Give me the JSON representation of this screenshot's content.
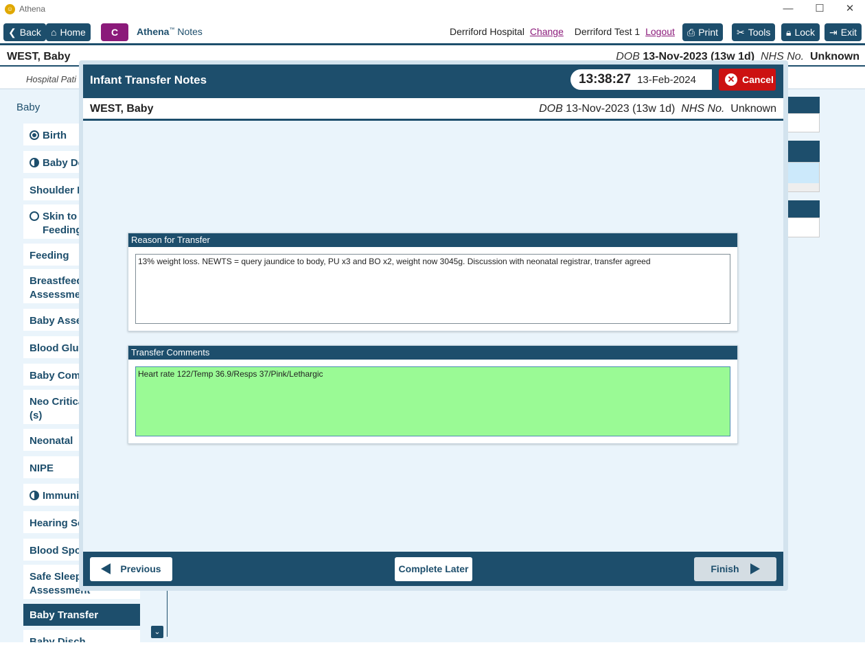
{
  "window": {
    "app_name": "Athena",
    "logo_glyph": "⌂"
  },
  "toolbar": {
    "back_label": "Back",
    "home_label": "Home",
    "c_label": "C",
    "brand": "Athena",
    "brand_tm": "™",
    "brand_suffix": "Notes",
    "hospital": "Derriford Hospital",
    "change_link": "Change",
    "user": "Derriford Test 1",
    "logout_link": "Logout",
    "print_label": "Print",
    "tools_label": "Tools",
    "lock_label": "Lock",
    "exit_label": "Exit"
  },
  "patient": {
    "name": "WEST, Baby",
    "dob_label": "DOB",
    "dob": "13-Nov-2023 (13w 1d)",
    "nhs_label": "NHS No.",
    "nhs": "Unknown"
  },
  "subbar_text": "Hospital Pati",
  "sidebar": {
    "header": "Baby",
    "items": [
      {
        "label": "Birth",
        "state": "complete"
      },
      {
        "label": "Baby De",
        "state": "partial"
      },
      {
        "label": "Shoulder D",
        "state": "none"
      },
      {
        "label": "Skin to S\nFeeding",
        "state": "empty"
      },
      {
        "label": "Feeding",
        "state": "none"
      },
      {
        "label": "Breastfeedi\nAssessmen",
        "state": "none"
      },
      {
        "label": "Baby Asses",
        "state": "none"
      },
      {
        "label": "Blood Gluc",
        "state": "none"
      },
      {
        "label": "Baby Comr",
        "state": "none"
      },
      {
        "label": "Neo Critica\n(s)",
        "state": "none"
      },
      {
        "label": "Neonatal",
        "state": "none"
      },
      {
        "label": "NIPE",
        "state": "none"
      },
      {
        "label": "Immunis",
        "state": "partial"
      },
      {
        "label": "Hearing Sc",
        "state": "none"
      },
      {
        "label": "Blood Spot",
        "state": "none"
      },
      {
        "label": "Safe Sleepi\nAssessment",
        "state": "none"
      },
      {
        "label": "Baby Transfer",
        "state": "active"
      },
      {
        "label": "Baby Disch",
        "state": "none"
      }
    ]
  },
  "modal": {
    "title": "Infant Transfer Notes",
    "time": "13:38:27",
    "date": "13-Feb-2024",
    "cancel_label": "Cancel",
    "reason_heading": "Reason for Transfer",
    "reason_text": "13% weight loss. NEWTS = query jaundice to body, PU x3 and BO x2, weight now 3045g. Discussion with neonatal registrar, transfer agreed",
    "comments_heading": "Transfer Comments",
    "comments_text": "Heart rate 122/Temp 36.9/Resps 37/Pink/Lethargic",
    "previous_label": "Previous",
    "complete_later_label": "Complete Later",
    "finish_label": "Finish"
  },
  "colors": {
    "primary": "#1d4e6c",
    "accent": "#8b1a7a",
    "cancel": "#cc1111",
    "comment_bg": "#9afa95"
  }
}
